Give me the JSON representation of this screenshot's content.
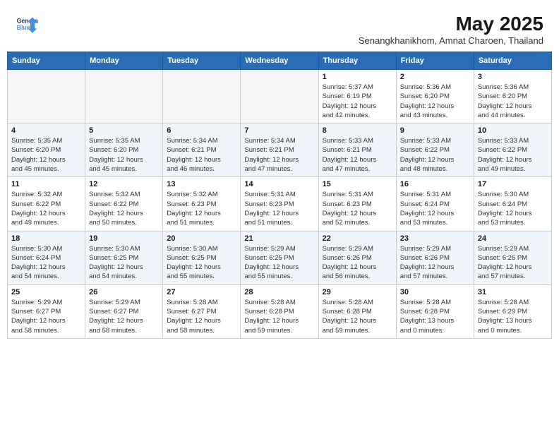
{
  "header": {
    "logo_line1": "General",
    "logo_line2": "Blue",
    "month_title": "May 2025",
    "subtitle": "Senangkhanikhom, Amnat Charoen, Thailand"
  },
  "weekdays": [
    "Sunday",
    "Monday",
    "Tuesday",
    "Wednesday",
    "Thursday",
    "Friday",
    "Saturday"
  ],
  "weeks": [
    [
      {
        "day": "",
        "info": ""
      },
      {
        "day": "",
        "info": ""
      },
      {
        "day": "",
        "info": ""
      },
      {
        "day": "",
        "info": ""
      },
      {
        "day": "1",
        "info": "Sunrise: 5:37 AM\nSunset: 6:19 PM\nDaylight: 12 hours\nand 42 minutes."
      },
      {
        "day": "2",
        "info": "Sunrise: 5:36 AM\nSunset: 6:20 PM\nDaylight: 12 hours\nand 43 minutes."
      },
      {
        "day": "3",
        "info": "Sunrise: 5:36 AM\nSunset: 6:20 PM\nDaylight: 12 hours\nand 44 minutes."
      }
    ],
    [
      {
        "day": "4",
        "info": "Sunrise: 5:35 AM\nSunset: 6:20 PM\nDaylight: 12 hours\nand 45 minutes."
      },
      {
        "day": "5",
        "info": "Sunrise: 5:35 AM\nSunset: 6:20 PM\nDaylight: 12 hours\nand 45 minutes."
      },
      {
        "day": "6",
        "info": "Sunrise: 5:34 AM\nSunset: 6:21 PM\nDaylight: 12 hours\nand 46 minutes."
      },
      {
        "day": "7",
        "info": "Sunrise: 5:34 AM\nSunset: 6:21 PM\nDaylight: 12 hours\nand 47 minutes."
      },
      {
        "day": "8",
        "info": "Sunrise: 5:33 AM\nSunset: 6:21 PM\nDaylight: 12 hours\nand 47 minutes."
      },
      {
        "day": "9",
        "info": "Sunrise: 5:33 AM\nSunset: 6:22 PM\nDaylight: 12 hours\nand 48 minutes."
      },
      {
        "day": "10",
        "info": "Sunrise: 5:33 AM\nSunset: 6:22 PM\nDaylight: 12 hours\nand 49 minutes."
      }
    ],
    [
      {
        "day": "11",
        "info": "Sunrise: 5:32 AM\nSunset: 6:22 PM\nDaylight: 12 hours\nand 49 minutes."
      },
      {
        "day": "12",
        "info": "Sunrise: 5:32 AM\nSunset: 6:22 PM\nDaylight: 12 hours\nand 50 minutes."
      },
      {
        "day": "13",
        "info": "Sunrise: 5:32 AM\nSunset: 6:23 PM\nDaylight: 12 hours\nand 51 minutes."
      },
      {
        "day": "14",
        "info": "Sunrise: 5:31 AM\nSunset: 6:23 PM\nDaylight: 12 hours\nand 51 minutes."
      },
      {
        "day": "15",
        "info": "Sunrise: 5:31 AM\nSunset: 6:23 PM\nDaylight: 12 hours\nand 52 minutes."
      },
      {
        "day": "16",
        "info": "Sunrise: 5:31 AM\nSunset: 6:24 PM\nDaylight: 12 hours\nand 53 minutes."
      },
      {
        "day": "17",
        "info": "Sunrise: 5:30 AM\nSunset: 6:24 PM\nDaylight: 12 hours\nand 53 minutes."
      }
    ],
    [
      {
        "day": "18",
        "info": "Sunrise: 5:30 AM\nSunset: 6:24 PM\nDaylight: 12 hours\nand 54 minutes."
      },
      {
        "day": "19",
        "info": "Sunrise: 5:30 AM\nSunset: 6:25 PM\nDaylight: 12 hours\nand 54 minutes."
      },
      {
        "day": "20",
        "info": "Sunrise: 5:30 AM\nSunset: 6:25 PM\nDaylight: 12 hours\nand 55 minutes."
      },
      {
        "day": "21",
        "info": "Sunrise: 5:29 AM\nSunset: 6:25 PM\nDaylight: 12 hours\nand 55 minutes."
      },
      {
        "day": "22",
        "info": "Sunrise: 5:29 AM\nSunset: 6:26 PM\nDaylight: 12 hours\nand 56 minutes."
      },
      {
        "day": "23",
        "info": "Sunrise: 5:29 AM\nSunset: 6:26 PM\nDaylight: 12 hours\nand 57 minutes."
      },
      {
        "day": "24",
        "info": "Sunrise: 5:29 AM\nSunset: 6:26 PM\nDaylight: 12 hours\nand 57 minutes."
      }
    ],
    [
      {
        "day": "25",
        "info": "Sunrise: 5:29 AM\nSunset: 6:27 PM\nDaylight: 12 hours\nand 58 minutes."
      },
      {
        "day": "26",
        "info": "Sunrise: 5:29 AM\nSunset: 6:27 PM\nDaylight: 12 hours\nand 58 minutes."
      },
      {
        "day": "27",
        "info": "Sunrise: 5:28 AM\nSunset: 6:27 PM\nDaylight: 12 hours\nand 58 minutes."
      },
      {
        "day": "28",
        "info": "Sunrise: 5:28 AM\nSunset: 6:28 PM\nDaylight: 12 hours\nand 59 minutes."
      },
      {
        "day": "29",
        "info": "Sunrise: 5:28 AM\nSunset: 6:28 PM\nDaylight: 12 hours\nand 59 minutes."
      },
      {
        "day": "30",
        "info": "Sunrise: 5:28 AM\nSunset: 6:28 PM\nDaylight: 13 hours\nand 0 minutes."
      },
      {
        "day": "31",
        "info": "Sunrise: 5:28 AM\nSunset: 6:29 PM\nDaylight: 13 hours\nand 0 minutes."
      }
    ]
  ]
}
